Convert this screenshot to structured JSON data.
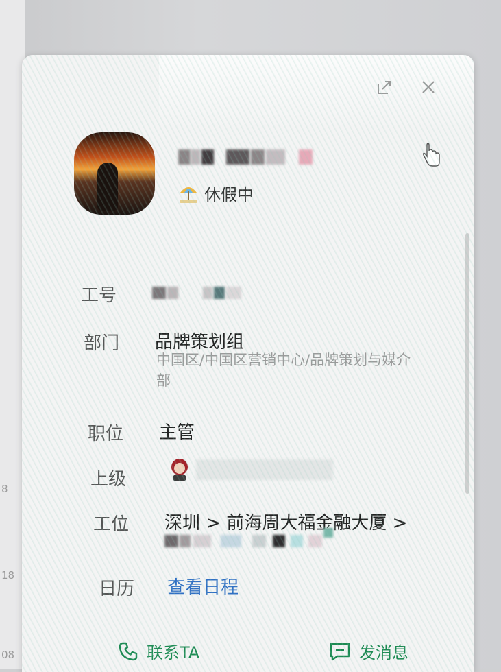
{
  "status": {
    "text": "休假中",
    "icon": "beach-umbrella-icon"
  },
  "fields": {
    "employee_id": {
      "label": "工号"
    },
    "department": {
      "label": "部门",
      "value": "品牌策划组",
      "path": "中国区/中国区营销中心/品牌策划与媒介部"
    },
    "position": {
      "label": "职位",
      "value": "主管"
    },
    "manager": {
      "label": "上级"
    },
    "workstation": {
      "label": "工位",
      "value": "深圳 > 前海周大福金融大厦 >"
    },
    "calendar": {
      "label": "日历",
      "link": "查看日程"
    }
  },
  "footer": {
    "contact_label": "联系TA",
    "message_label": "发消息"
  },
  "side_numbers": [
    "8",
    "18",
    "08"
  ],
  "colors": {
    "accent_green": "#1c8a52",
    "link_blue": "#2f6fc4"
  },
  "icons": [
    "share-icon",
    "close-icon",
    "phone-icon",
    "message-icon"
  ]
}
